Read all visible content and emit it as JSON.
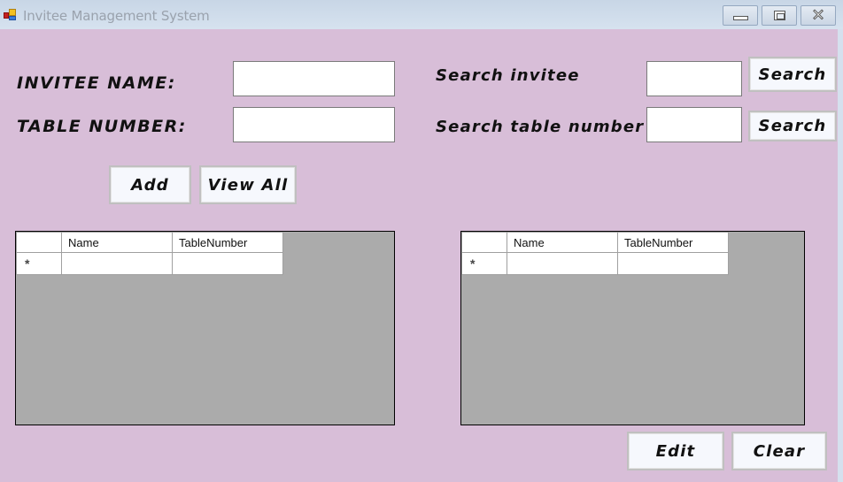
{
  "window": {
    "title": "Invitee Management System",
    "icon": "app-icon",
    "controls": {
      "minimize": "minimize-icon",
      "maximize": "maximize-icon",
      "close": "close-icon"
    }
  },
  "form": {
    "invitee_name_label": "INVITEE NAME:",
    "invitee_name_value": "",
    "table_number_label": "TABLE NUMBER:",
    "table_number_value": "",
    "add_label": "Add",
    "view_all_label": "View All"
  },
  "search": {
    "invitee_label": "Search invitee",
    "invitee_value": "",
    "invitee_button": "Search",
    "table_label": "Search table number",
    "table_value": "",
    "table_button": "Search"
  },
  "grids": {
    "left": {
      "columns": [
        "Name",
        "TableNumber"
      ],
      "new_row_marker": "*",
      "rows": []
    },
    "right": {
      "columns": [
        "Name",
        "TableNumber"
      ],
      "new_row_marker": "*",
      "rows": []
    }
  },
  "actions": {
    "edit_label": "Edit",
    "clear_label": "Clear"
  },
  "colors": {
    "background": "#d8bed8",
    "grid_background": "#ababab",
    "button_face": "#f6f8fd"
  }
}
